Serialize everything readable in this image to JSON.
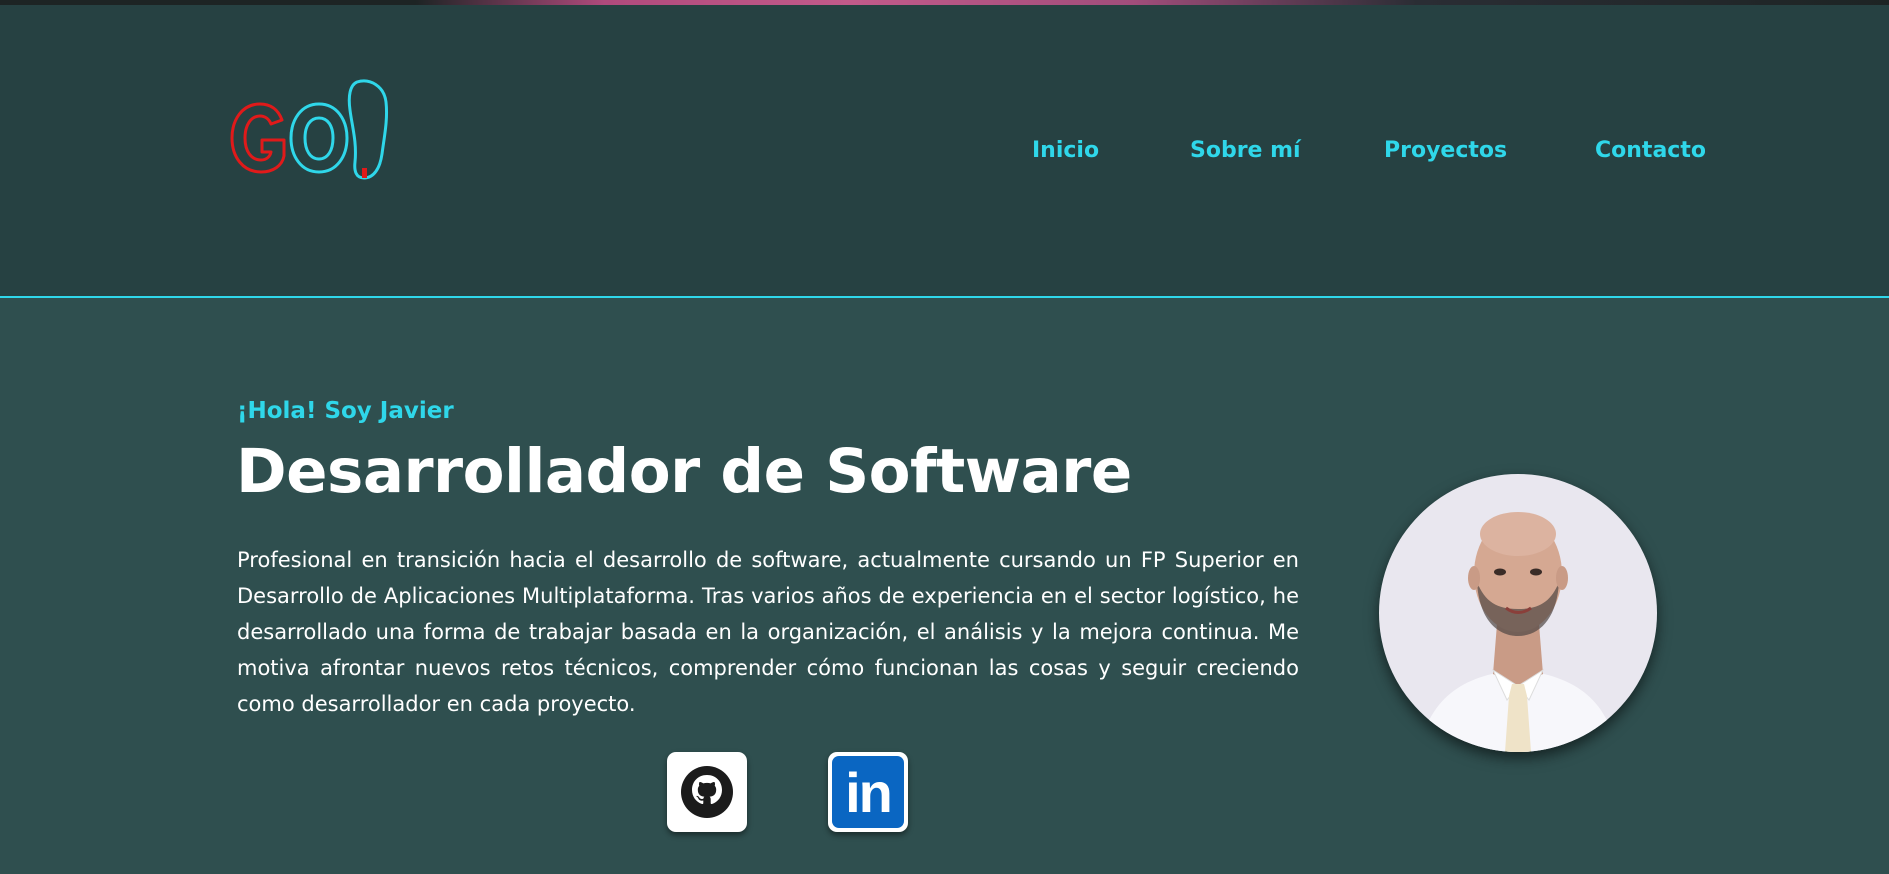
{
  "brand": {
    "logo_text": "GO!",
    "colors": {
      "accent": "#2fd7ea",
      "logo_red": "#e01a1a",
      "header_bg": "#264142",
      "main_bg": "#2f4f4f"
    }
  },
  "nav": {
    "items": [
      {
        "label": "Inicio"
      },
      {
        "label": "Sobre mí"
      },
      {
        "label": "Proyectos"
      },
      {
        "label": "Contacto"
      }
    ]
  },
  "hero": {
    "greeting": "¡Hola! Soy Javier",
    "title": "Desarrollador de Software",
    "bio": "Profesional en transición hacia el desarrollo de software, actualmente cursando un FP Superior en Desarrollo de Aplicaciones Multiplataforma. Tras varios años de experiencia en el sector logístico, he desarrollado una forma de trabajar basada en la organización, el análisis y la mejora continua. Me motiva afrontar nuevos retos técnicos, comprender cómo funcionan las cosas y seguir creciendo como desarrollador en cada proyecto."
  },
  "social": {
    "github_icon": "github-icon",
    "linkedin_icon": "linkedin-icon",
    "linkedin_text": "in"
  },
  "profile": {
    "avatar_icon": "profile-photo"
  }
}
